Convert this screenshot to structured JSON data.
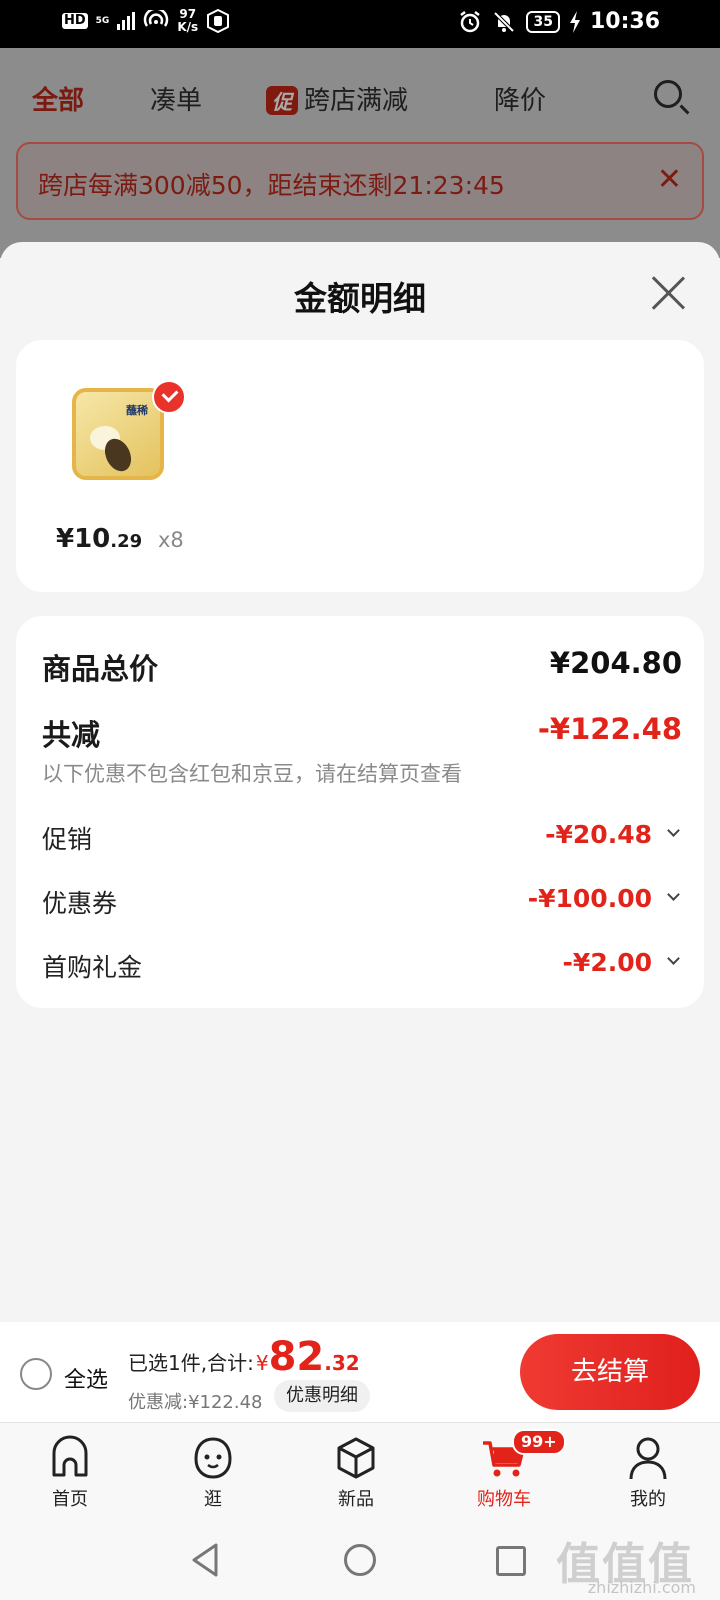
{
  "status_bar": {
    "hd": "HD",
    "network": "5G",
    "speed_value": "97",
    "speed_unit": "K/s",
    "battery": "35",
    "time": "10:36"
  },
  "background": {
    "tabs": [
      "全部",
      "凑单",
      "跨店满减",
      "降价"
    ],
    "promo_tag": "促",
    "banner_text": "跨店每满300减50，距结束还剩21:23:45",
    "banner_close": "✕"
  },
  "sheet": {
    "title": "金额明细",
    "product": {
      "brand_label": "蘸稀",
      "price_symbol": "¥",
      "price_int": "10",
      "price_dec": ".29",
      "quantity": "x8"
    },
    "summary": {
      "total_label": "商品总价",
      "total_value": "¥204.80",
      "reduce_label": "共减",
      "reduce_value": "-¥122.48",
      "note": "以下优惠不包含红包和京豆，请在结算页查看",
      "items": [
        {
          "label": "促销",
          "value": "-¥20.48"
        },
        {
          "label": "优惠券",
          "value": "-¥100.00"
        },
        {
          "label": "首购礼金",
          "value": "-¥2.00"
        }
      ]
    }
  },
  "checkout": {
    "select_all": "全选",
    "selected_text": "已选1件,合计:",
    "total_symbol": "¥",
    "total_int": "82",
    "total_dec": ".32",
    "discount_text": "优惠减:¥122.48",
    "detail_button": "优惠明细",
    "pay_button": "去结算"
  },
  "bottom_nav": {
    "items": [
      {
        "label": "首页",
        "icon": "home-icon"
      },
      {
        "label": "逛",
        "icon": "stroll-face-icon"
      },
      {
        "label": "新品",
        "icon": "cube-icon"
      },
      {
        "label": "购物车",
        "icon": "cart-icon"
      },
      {
        "label": "我的",
        "icon": "profile-icon"
      }
    ],
    "cart_badge": "99+",
    "active": "购物车"
  },
  "watermark": {
    "text": "值值值",
    "url": "zhizhizhi.com"
  },
  "colors": {
    "accent": "#e2231a",
    "sheet_bg": "#f4f4f4",
    "card_bg": "#ffffff"
  }
}
